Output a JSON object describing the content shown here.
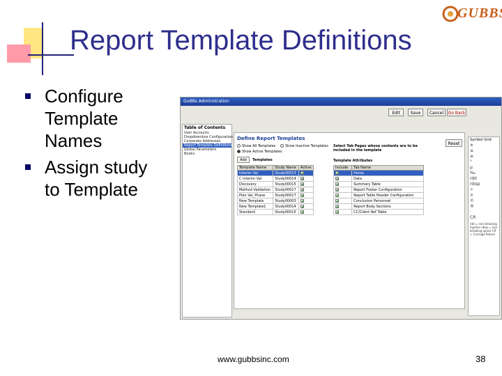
{
  "slide": {
    "title": "Report Template Definitions",
    "bullets": [
      "Configure Template Names",
      "Assign study to Template"
    ],
    "footer": "www.gubbsinc.com",
    "page_number": "38",
    "logo_text": "GUBBS"
  },
  "screenshot": {
    "window_title": "GuBBs Administration",
    "toolbar": {
      "edit": "Edit",
      "save": "Save",
      "cancel": "Cancel",
      "go_back": "Go Back"
    },
    "toc": {
      "heading": "Table of Contents",
      "items": [
        "User Accounts",
        "Dropdownbox Configuration",
        "Corporate Addresses",
        "Report Template Definitions",
        "Global Parameters",
        "Books"
      ],
      "selected_index": 3
    },
    "define": {
      "heading": "Define Report Templates",
      "reset": "Reset",
      "radio_all": "Show All Templates",
      "radio_inactive": "Show Inactive Templates",
      "radio_active": "Show Active Templates",
      "add": "Add",
      "templates_label": "Templates",
      "columns": [
        "Template Name",
        "Study Name",
        "Active"
      ],
      "rows": [
        {
          "name": "Interim Val",
          "study": "Study00013",
          "active": true
        },
        {
          "name": "C Interim Val",
          "study": "Study00014",
          "active": true
        },
        {
          "name": "Discovery",
          "study": "Study00015",
          "active": true
        },
        {
          "name": "Method Validation",
          "study": "Study00017",
          "active": true
        },
        {
          "name": "Plan Val_Phase",
          "study": "Study00017",
          "active": true
        },
        {
          "name": "New Template",
          "study": "Study00003",
          "active": true
        },
        {
          "name": "New Template1",
          "study": "Study00014",
          "active": true
        },
        {
          "name": "Standard",
          "study": "Study00015",
          "active": true
        }
      ],
      "selected_row": 0
    },
    "attributes": {
      "instruction": "Select Tab Pages whose contents are to be included in the template",
      "label": "Template Attributes",
      "columns": [
        "Include",
        "Tab Name"
      ],
      "rows": [
        {
          "include": true,
          "tab": "Home"
        },
        {
          "include": true,
          "tab": "Data"
        },
        {
          "include": true,
          "tab": "Summary Table"
        },
        {
          "include": true,
          "tab": "Report Footer Configuration"
        },
        {
          "include": true,
          "tab": "Report Table Header Configuration"
        },
        {
          "include": true,
          "tab": "Conclusion Personnel"
        },
        {
          "include": true,
          "tab": "Report Body Sections"
        },
        {
          "include": true,
          "tab": "CC/Client Ref Table"
        }
      ],
      "selected_row": 0
    },
    "symbol_grid": {
      "label": "Symbol Grid",
      "symbols": [
        "±",
        "≤",
        "≥",
        "°",
        "µ",
        "‰",
        "nbt",
        "nbsp",
        "÷",
        "×",
        "©",
        "®",
        "·",
        "CR"
      ],
      "legend": "nbt = non breaking hyphen nbsp = non breaking space CR = Carriage Return"
    }
  }
}
